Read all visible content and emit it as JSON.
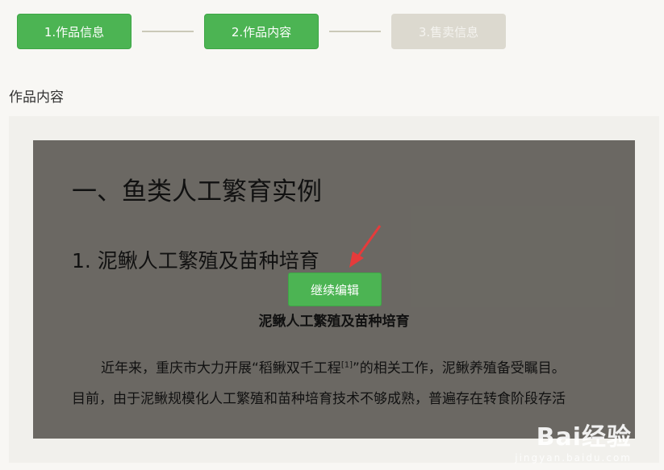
{
  "steps": [
    {
      "label": "1.作品信息"
    },
    {
      "label": "2.作品内容"
    },
    {
      "label": "3.售卖信息"
    }
  ],
  "section_label": "作品内容",
  "editor": {
    "heading1": "一、鱼类人工繁育实例",
    "heading2": "1. 泥鳅人工繁殖及苗种培育",
    "continue_button": "继续编辑",
    "center_title": "泥鳅人工繁殖及苗种培育",
    "para1_part1": "近年来，重庆市大力开展“稻鳅双千工程",
    "para1_sup": "[1]",
    "para1_part2": "”的相关工作，泥鳅养殖备受瞩目。",
    "para2": "目前，由于泥鳅规模化人工繁殖和苗种培育技术不够成熟，普遍存在转食阶段存活"
  },
  "watermark": {
    "logo": "Bai经验",
    "url": "jingyan.baidu.com"
  },
  "colors": {
    "accent": "#4cb453",
    "pending": "#dcd9cf",
    "arrow": "#e53b3b"
  }
}
